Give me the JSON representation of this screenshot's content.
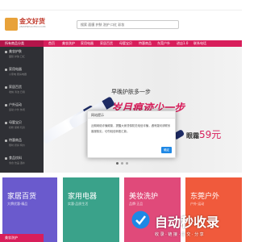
{
  "header": {
    "logo_text": "金文好货",
    "logo_sub": "JINWENHAOHUO.COM",
    "search_placeholder": "搜索 面膜 护肤 洗护 口红 彩妆"
  },
  "nav": {
    "category_label": "所有商品分类",
    "items": [
      "首页",
      "美妆洗护",
      "家用电器",
      "家居百货",
      "母婴宝贝",
      "特惠商品",
      "东莞户外",
      "进店1.0",
      "联系电话"
    ]
  },
  "sidebar": {
    "items": [
      {
        "title": "美妆护肤",
        "sub": "面膜 护肤 口红"
      },
      {
        "title": "家用电器",
        "sub": "小家电 厨房电器"
      },
      {
        "title": "家居百货",
        "sub": "收纳 清洁 日用"
      },
      {
        "title": "户外运动",
        "sub": "运动 户外 休闲"
      },
      {
        "title": "母婴宝贝",
        "sub": "奶粉 尿裤 玩具"
      },
      {
        "title": "特惠商品",
        "sub": "限时 折扣 特价"
      },
      {
        "title": "食品饮料",
        "sub": "零食 饮品 酒水"
      }
    ]
  },
  "banner": {
    "headline": "早晚护肤多一步",
    "slogan": "岁月痕迹少一步",
    "product": "眼霜",
    "price": "59元"
  },
  "dialog": {
    "title": "网站提示",
    "body": "近期网络诈骗频繁，提醒大家谨慎防范电信诈骗，遇有疑问请联系客服核实，切勿轻信转账汇款。",
    "button": "确定"
  },
  "cards": [
    {
      "title": "家居百货",
      "sub": "大牌优惠·精品",
      "color": "#6a5acd"
    },
    {
      "title": "家用电器",
      "sub": "实惠·品质生活",
      "color": "#3aa28a"
    },
    {
      "title": "美妆洗护",
      "sub": "品牌·正品",
      "color": "#e04a7a"
    },
    {
      "title": "东莞户外",
      "sub": "户外·运动",
      "color": "#f05a3c"
    }
  ],
  "bottom_tag": "美妆洗护",
  "watermark": {
    "text": "自动秒收录",
    "sub": "收 录 · 链 接 · 提 交 · 分 享"
  },
  "colors": {
    "brand": "#d81e5b",
    "sidebar": "#2f3035",
    "dialog_button": "#1e88e5"
  }
}
